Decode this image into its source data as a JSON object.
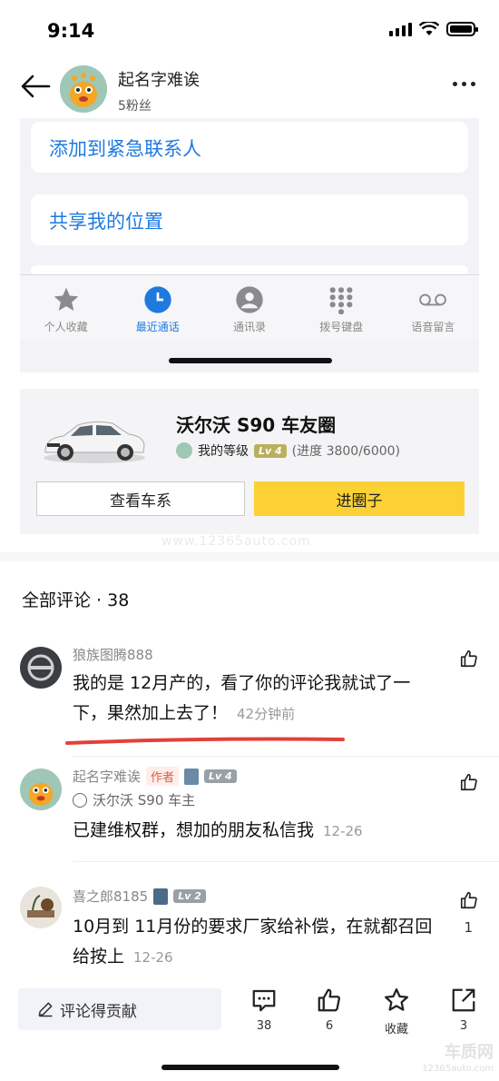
{
  "status_bar": {
    "time": "9:14"
  },
  "header": {
    "name": "起名字难诶",
    "fans": "5粉丝"
  },
  "embedded": {
    "card1": "添加到紧急联系人",
    "card2": "共享我的位置",
    "tabs": [
      {
        "label": "个人收藏",
        "icon": "star-icon"
      },
      {
        "label": "最近通话",
        "icon": "clock-icon"
      },
      {
        "label": "通讯录",
        "icon": "person-icon"
      },
      {
        "label": "拨号键盘",
        "icon": "keypad-icon"
      },
      {
        "label": "语音留言",
        "icon": "voicemail-icon"
      }
    ]
  },
  "circle": {
    "title": "沃尔沃 S90 车友圈",
    "level_label": "我的等级",
    "level_badge": "Lv 4",
    "progress": "(进度 3800/6000)",
    "btn_series": "查看车系",
    "btn_join": "进圈子"
  },
  "watermark": "www.12365auto.com",
  "comments_title": "全部评论 · 38",
  "comments": [
    {
      "name": "狼族图腾888",
      "text": "我的是 12月产的，看了你的评论我就试了一下，果然加上去了！",
      "time": "42分钟前",
      "likes": ""
    },
    {
      "name": "起名字难诶",
      "author_tag": "作者",
      "level_badge": "Lv 4",
      "owner": "沃尔沃 S90 车主",
      "text": "已建维权群，想加的朋友私信我",
      "time": "12-26",
      "likes": ""
    },
    {
      "name": "喜之郎8185",
      "level_badge": "Lv 2",
      "text": "10月到 11月份的要求厂家给补偿，在就都召回给按上",
      "time": "12-26",
      "likes": "1"
    }
  ],
  "bottom_bar": {
    "write_label": "评论得贡献",
    "comment_count": "38",
    "like_count": "6",
    "favorite_label": "收藏",
    "share_count": "3"
  },
  "logo_watermark": {
    "main": "车质网",
    "sub": "12365auto.com"
  },
  "colors": {
    "accent_blue": "#1f7ae0",
    "join_yellow": "#fcd136",
    "underline_red": "#e2403a"
  }
}
